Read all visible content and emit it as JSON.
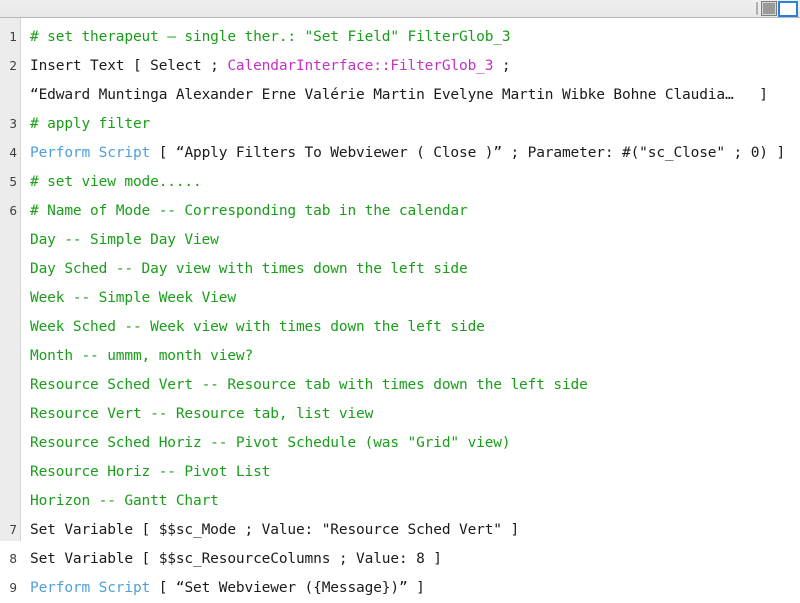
{
  "toolbar": {
    "separator_name": "toolbar-separator",
    "buttons": [
      {
        "name": "view-toggle-filled",
        "label": ""
      },
      {
        "name": "view-toggle-active",
        "label": ""
      }
    ]
  },
  "editor": {
    "script_lines": [
      {
        "number": "1",
        "type": "comment",
        "text": "# set therapeut – single ther.: \"Set Field\" FilterGlob_3"
      },
      {
        "number": "2",
        "type": "statement",
        "prefix": "Insert Text [ Select ; ",
        "field": "CalendarInterface::FilterGlob_3",
        "suffix": " ;"
      },
      {
        "number": "",
        "type": "continuation",
        "text": "“Edward Muntinga Alexander Erne Valérie Martin Evelyne Martin Wibke Bohne Claudia…   ]"
      },
      {
        "number": "3",
        "type": "comment",
        "text": "# apply filter"
      },
      {
        "number": "4",
        "type": "keyword-statement",
        "keyword": "Perform Script",
        "rest": " [ “Apply Filters To Webviewer ( Close )” ; Parameter: #(\"sc_Close\" ; 0) ]"
      },
      {
        "number": "5",
        "type": "comment",
        "text": "# set view mode....."
      },
      {
        "number": "6",
        "type": "comment",
        "text": "# Name of Mode -- Corresponding tab in the calendar"
      },
      {
        "number": "",
        "type": "comment-indent",
        "text": "Day -- Simple Day View"
      },
      {
        "number": "",
        "type": "comment-indent",
        "text": "Day Sched -- Day view with times down the left side"
      },
      {
        "number": "",
        "type": "comment-indent",
        "text": "Week -- Simple Week View"
      },
      {
        "number": "",
        "type": "comment-indent",
        "text": "Week Sched -- Week view with times down the left side"
      },
      {
        "number": "",
        "type": "comment-indent",
        "text": "Month -- ummm, month view?"
      },
      {
        "number": "",
        "type": "comment-indent",
        "text": "Resource Sched Vert -- Resource tab with times down the left side"
      },
      {
        "number": "",
        "type": "comment-indent",
        "text": "Resource Vert -- Resource tab, list view"
      },
      {
        "number": "",
        "type": "comment-indent",
        "text": "Resource Sched Horiz -- Pivot Schedule (was \"Grid\" view)"
      },
      {
        "number": "",
        "type": "comment-indent",
        "text": "Resource Horiz -- Pivot List"
      },
      {
        "number": "",
        "type": "comment-indent",
        "text": "Horizon -- Gantt Chart"
      },
      {
        "number": "7",
        "type": "statement",
        "text": "Set Variable [ $$sc_Mode ; Value: \"Resource Sched Vert\" ]"
      },
      {
        "number": "8",
        "type": "statement",
        "text": "Set Variable [ $$sc_ResourceColumns ; Value: 8 ]"
      },
      {
        "number": "9",
        "type": "keyword-statement",
        "keyword": "Perform Script",
        "rest": " [ “Set Webviewer ({Message})” ]"
      }
    ]
  },
  "colors": {
    "comment_green": "#1a9e1a",
    "keyword_blue": "#4f9fdc",
    "field_magenta": "#c632c6",
    "text_black": "#1b1b1b",
    "gutter_grey": "#ececec",
    "toolbar_grey": "#e8e8e8",
    "accent_blue": "#2b7fd4"
  }
}
